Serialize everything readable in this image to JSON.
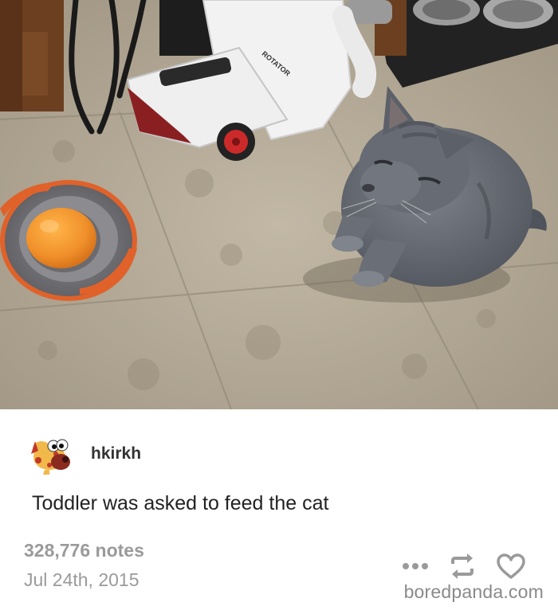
{
  "post": {
    "username": "hkirkh",
    "caption": "Toddler was asked to feed the cat",
    "notes": "328,776 notes",
    "date": "Jul 24th, 2015"
  },
  "photo": {
    "vacuum_label": "ROTATOR"
  },
  "icons": {
    "more": "more-dots-icon",
    "reblog": "reblog-icon",
    "like": "heart-icon"
  },
  "watermark": "boredpanda.com",
  "colors": {
    "floor": "#b4a995",
    "bowl_rim": "#e0622a",
    "orange": "#f2962a",
    "cat": "#6b6f78",
    "text_muted": "#9a9a9a"
  }
}
